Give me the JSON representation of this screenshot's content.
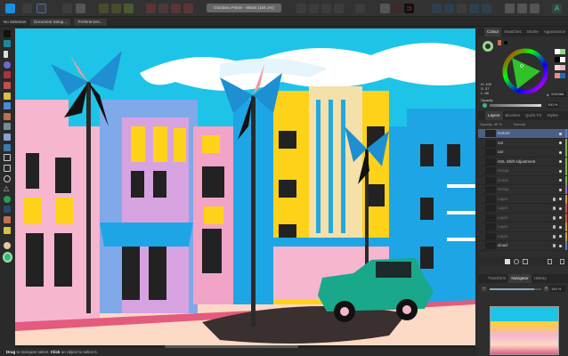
{
  "toolbar": {
    "document_title": "Giordano Poloni - Miami (154.1%)"
  },
  "context": {
    "selection": "No Selection",
    "document_setup": "Document Setup...",
    "preferences": "Preferences..."
  },
  "status": {
    "drag": "Drag",
    "drag_text": " to marquee select. ",
    "click": "Click",
    "click_text": " an object to select it."
  },
  "colour_panel": {
    "tabs": [
      "Colour",
      "Swatches",
      "Stroke",
      "Appearance"
    ],
    "h": "H: 108",
    "s": "S: 37",
    "l": "L: 66",
    "hex_label": "#:",
    "hex": "92D98A",
    "opacity_label": "Opacity",
    "opacity": "100 %",
    "current_color": "#92D98A",
    "swatches": [
      "#ffffff",
      "#92d98a",
      "#000000",
      "#ffffff",
      "#f8d4dc",
      "#e4b5c4",
      "#f28a8a",
      "#1a6fb5",
      "#111111"
    ]
  },
  "layers_panel": {
    "tabs": [
      "Layers",
      "Brushes",
      "Quick FX",
      "Styles"
    ],
    "opacity": "Opacity: 40 %",
    "blend": "Normal",
    "items": [
      {
        "name": "texture",
        "dim": false,
        "tag": "#5b7fc4",
        "selected": true
      },
      {
        "name": "car",
        "dim": false,
        "tag": "#7ab648"
      },
      {
        "name": "car",
        "dim": false,
        "tag": "#7ab648"
      },
      {
        "name": "HSL Shift Adjustment",
        "dim": false,
        "tag": "#7ab648"
      },
      {
        "name": "Group",
        "dim": true,
        "tag": "#7ab648"
      },
      {
        "name": "Curve",
        "dim": true,
        "tag": "#7ab648"
      },
      {
        "name": "Group",
        "dim": true,
        "tag": "#9b6fc4"
      },
      {
        "name": "Layer",
        "dim": true,
        "tag": "#c9a227",
        "lock": true
      },
      {
        "name": "Layer",
        "dim": true,
        "tag": "#d0504f",
        "lock": true
      },
      {
        "name": "Layer",
        "dim": true,
        "tag": "#d0504f",
        "lock": true
      },
      {
        "name": "Layer",
        "dim": true,
        "tag": "#c9a227",
        "lock": true
      },
      {
        "name": "Layer",
        "dim": true,
        "tag": "#c9a227",
        "lock": true
      },
      {
        "name": "cloud",
        "dim": false,
        "tag": "#5b7fc4",
        "lock": true
      }
    ]
  },
  "navigator_panel": {
    "tabs": [
      "Transform",
      "Navigator",
      "History"
    ],
    "zoom": "154 %",
    "zoom_fraction": 0.87
  }
}
